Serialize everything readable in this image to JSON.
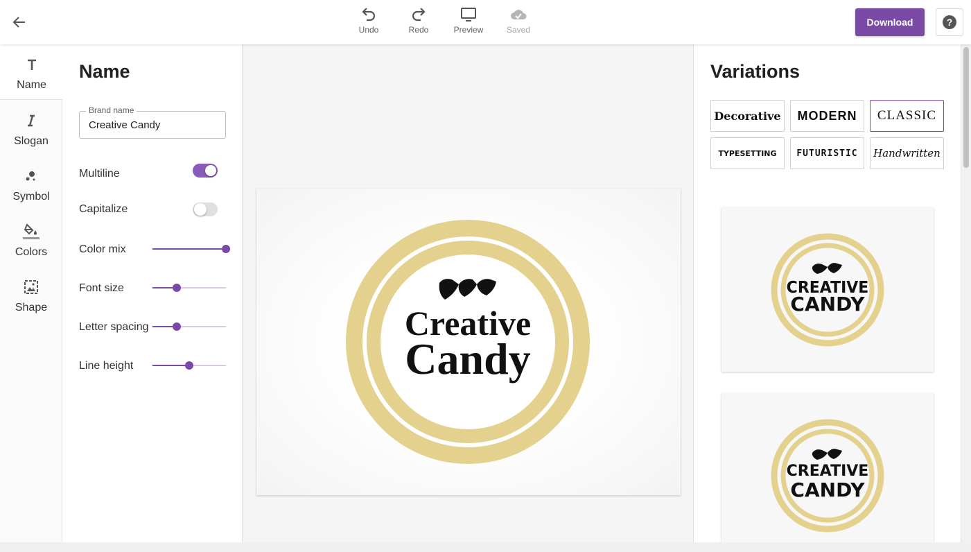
{
  "toolbar": {
    "undo": "Undo",
    "redo": "Redo",
    "preview": "Preview",
    "saved": "Saved",
    "download": "Download",
    "help": "?"
  },
  "nav": {
    "items": [
      {
        "label": "Name",
        "icon": "text-icon",
        "active": true
      },
      {
        "label": "Slogan",
        "icon": "italic-icon"
      },
      {
        "label": "Symbol",
        "icon": "dots-icon"
      },
      {
        "label": "Colors",
        "icon": "paint-bucket-icon"
      },
      {
        "label": "Shape",
        "icon": "image-frame-icon"
      }
    ]
  },
  "props": {
    "title": "Name",
    "brand_label": "Brand name",
    "brand_value": "Creative Candy",
    "multiline": {
      "label": "Multiline",
      "on": true
    },
    "capitalize": {
      "label": "Capitalize",
      "on": false
    },
    "color_mix": {
      "label": "Color mix",
      "value": 1.0
    },
    "font_size": {
      "label": "Font size",
      "value": 0.33
    },
    "letter_spacing": {
      "label": "Letter spacing",
      "value": 0.33
    },
    "line_height": {
      "label": "Line height",
      "value": 0.5
    }
  },
  "logo": {
    "line1": "Creative",
    "line2": "Candy",
    "ring_color": "#e3d18d",
    "text_color": "#111111"
  },
  "variations": {
    "title": "Variations",
    "styles": [
      "Decorative",
      "MODERN",
      "CLASSIC",
      "TYPESETTING",
      "FUTURISTIC",
      "Handwritten"
    ],
    "selected": "CLASSIC",
    "previews": [
      {
        "line1": "CREATIVE",
        "line2": "CANDY"
      },
      {
        "line1": "CREATIVE",
        "line2": "CANDY"
      }
    ]
  },
  "colors": {
    "accent": "#7a4aa6",
    "ring": "#e3d18d"
  }
}
